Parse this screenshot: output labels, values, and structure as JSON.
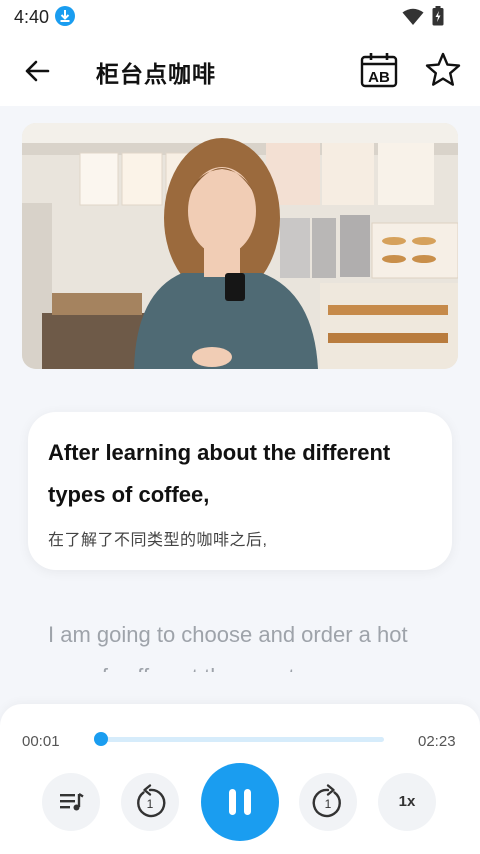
{
  "status_bar": {
    "time": "4:40"
  },
  "header": {
    "title": "柜台点咖啡",
    "ab_label": "AB"
  },
  "subtitle": {
    "current_en": "After learning about the different types of coffee,",
    "current_zh": "在了解了不同类型的咖啡之后,",
    "next_en": "I am going to choose and order a hot cup of coffee at the counter"
  },
  "player": {
    "current_time": "00:01",
    "duration": "02:23",
    "progress_fraction": 0.007,
    "speed_label": "1x",
    "rewind_label": "1",
    "forward_label": "1",
    "state": "playing"
  },
  "colors": {
    "accent": "#1a9df0"
  },
  "icons": [
    "download-icon",
    "wifi-icon",
    "battery-icon",
    "back-arrow-icon",
    "ab-calendar-icon",
    "star-icon",
    "playlist-icon",
    "rewind-icon",
    "pause-icon",
    "forward-icon"
  ]
}
